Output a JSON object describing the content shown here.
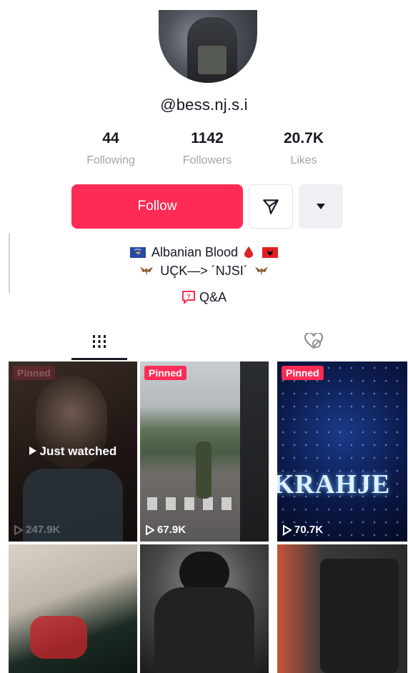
{
  "profile": {
    "username": "@bess.nj.s.i",
    "stats": [
      {
        "value": "44",
        "label": "Following"
      },
      {
        "value": "1142",
        "label": "Followers"
      },
      {
        "value": "20.7K",
        "label": "Likes"
      }
    ],
    "follow_label": "Follow",
    "bio_line1": "Albanian Blood",
    "bio_line2": "UÇK—> ´NJSI´",
    "qa_label": "Q&A"
  },
  "icons": {
    "message": "paper-plane-icon",
    "more": "caret-down-icon",
    "grid_tab": "grid-icon",
    "liked_tab": "hidden-heart-icon",
    "views": "play-icon"
  },
  "colors": {
    "accent": "#fe2c55",
    "text": "#161823",
    "secondary": "#a2a4a9"
  },
  "videos": [
    {
      "pinned": "Pinned",
      "views": "247.9K",
      "overlay": "Just watched"
    },
    {
      "pinned": "Pinned",
      "views": "67.9K"
    },
    {
      "pinned": "Pinned",
      "views": "70.7K",
      "caption": "KRAHJE"
    },
    {},
    {},
    {}
  ]
}
